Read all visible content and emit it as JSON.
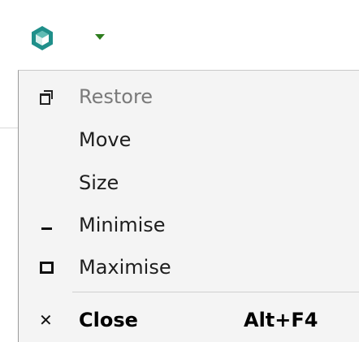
{
  "titlebar": {
    "app_icon": "app-logo-icon",
    "menu_arrow_icon": "chevron-down-icon",
    "colors": {
      "logo_primary": "#1f8f8a",
      "logo_light": "#ffffff",
      "arrow": "#2e7d1e"
    }
  },
  "system_menu": {
    "items": [
      {
        "label": "Restore",
        "icon": "restore-icon",
        "disabled": true,
        "shortcut": ""
      },
      {
        "label": "Move",
        "icon": "",
        "disabled": false,
        "shortcut": ""
      },
      {
        "label": "Size",
        "icon": "",
        "disabled": false,
        "shortcut": ""
      },
      {
        "label": "Minimise",
        "icon": "minimise-icon",
        "disabled": false,
        "shortcut": ""
      },
      {
        "label": "Maximise",
        "icon": "maximise-icon",
        "disabled": false,
        "shortcut": ""
      },
      {
        "label": "Close",
        "icon": "close-icon",
        "disabled": false,
        "shortcut": "Alt+F4",
        "bold": true
      }
    ],
    "close_glyph": "✕"
  }
}
